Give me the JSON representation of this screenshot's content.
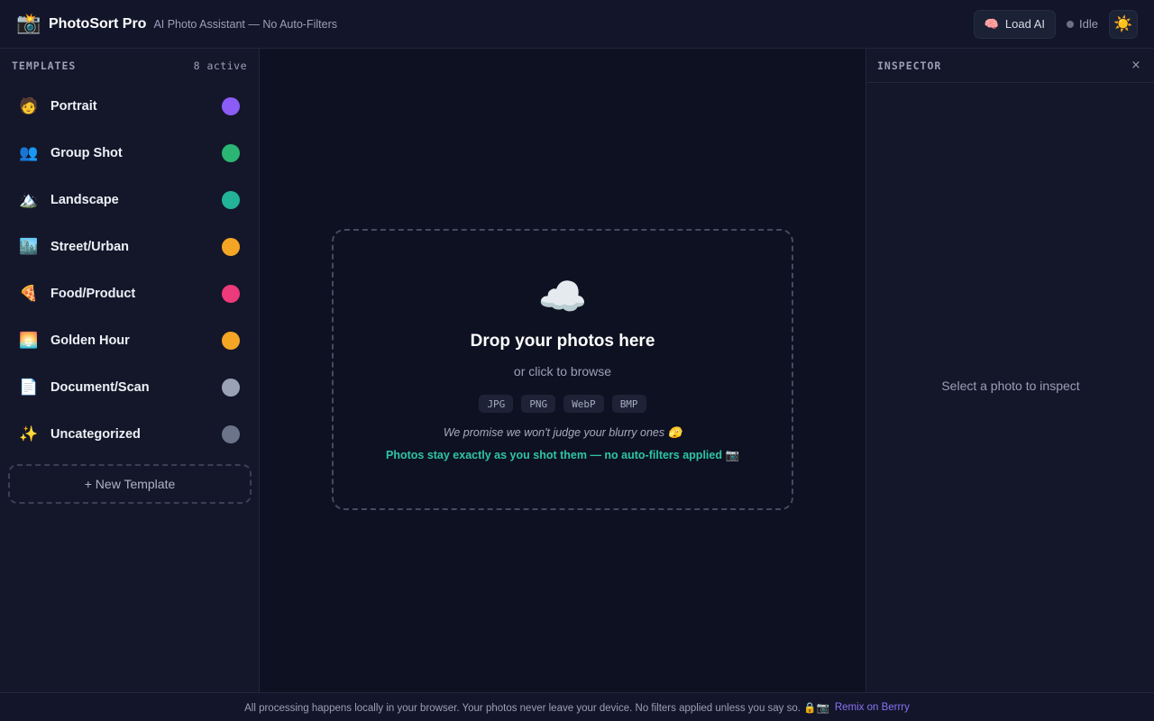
{
  "header": {
    "logo_icon": "📸",
    "title": "PhotoSort Pro",
    "subtitle": "AI Photo Assistant — No Auto-Filters",
    "load_ai_icon": "🧠",
    "load_ai_label": "Load AI",
    "status_label": "Idle",
    "theme_icon": "☀️"
  },
  "sidebar": {
    "heading": "TEMPLATES",
    "count": "8 active",
    "templates": [
      {
        "icon": "🧑",
        "name": "Portrait",
        "color": "#8b5cf6"
      },
      {
        "icon": "👥",
        "name": "Group Shot",
        "color": "#2bb673"
      },
      {
        "icon": "🏔️",
        "name": "Landscape",
        "color": "#22b39a"
      },
      {
        "icon": "🏙️",
        "name": "Street/Urban",
        "color": "#f5a524"
      },
      {
        "icon": "🍕",
        "name": "Food/Product",
        "color": "#ec3a7a"
      },
      {
        "icon": "🌅",
        "name": "Golden Hour",
        "color": "#f5a524"
      },
      {
        "icon": "📄",
        "name": "Document/Scan",
        "color": "#9aa3b5"
      },
      {
        "icon": "✨",
        "name": "Uncategorized",
        "color": "#6b7488"
      }
    ],
    "new_template_label": "+ New Template"
  },
  "dropzone": {
    "icon": "☁️",
    "title": "Drop your photos here",
    "subtitle": "or click to browse",
    "formats": [
      "JPG",
      "PNG",
      "WebP",
      "BMP"
    ],
    "joke": "We promise we won't judge your blurry ones 🫣",
    "note": "Photos stay exactly as you shot them — no auto-filters applied 📷"
  },
  "inspector": {
    "title": "INSPECTOR",
    "close_icon": "×",
    "empty_text": "Select a photo to inspect"
  },
  "footer": {
    "text": "All processing happens locally in your browser. Your photos never leave your device. No filters applied unless you say so. 🔒📷",
    "link": "Remix on Berrry"
  }
}
